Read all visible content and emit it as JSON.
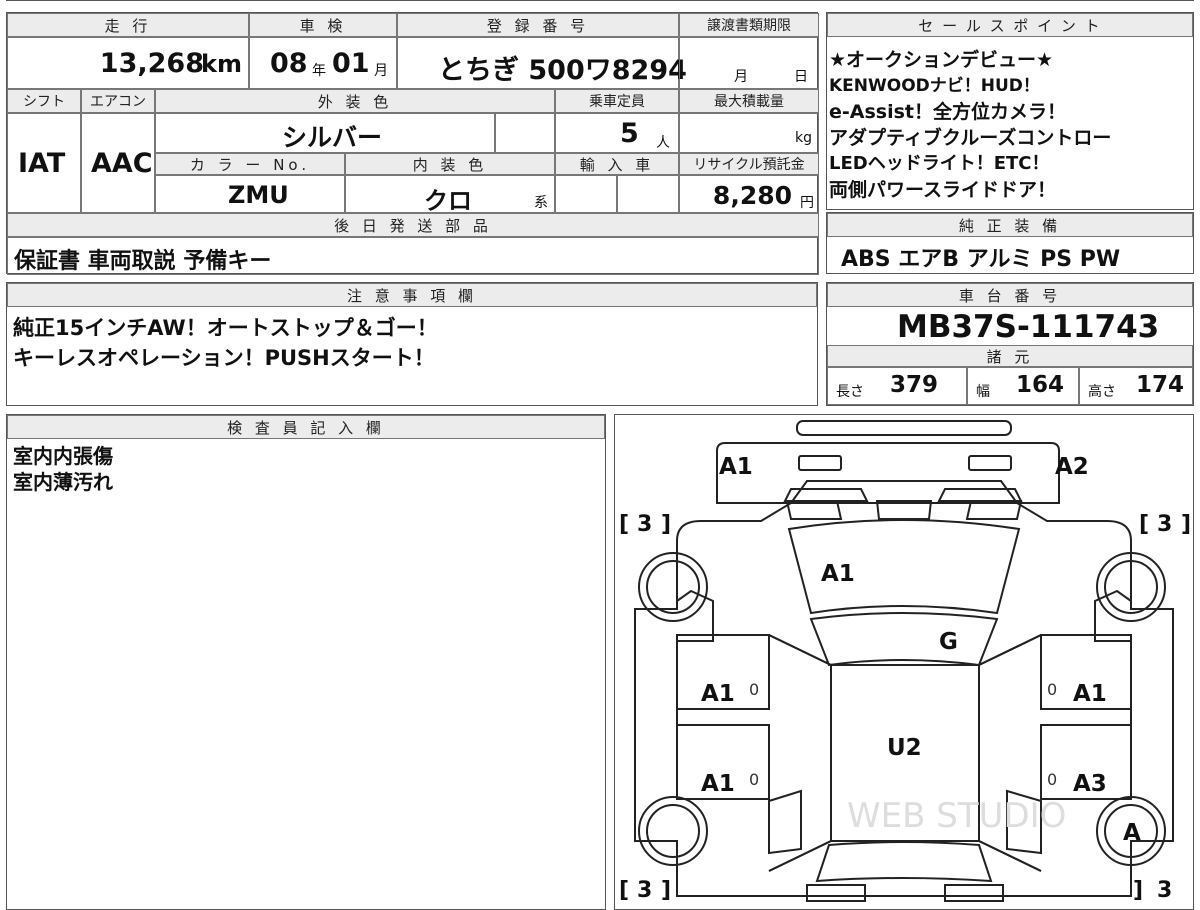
{
  "top_info": {
    "headers": {
      "mileage": "走 行",
      "inspection": "車 検",
      "registration": "登 録 番 号",
      "transfer_deadline": "譲渡書類期限",
      "shift": "シフト",
      "aircon": "エアコン",
      "exterior_color": "外 装 色",
      "capacity": "乗車定員",
      "max_load": "最大積載量",
      "color_no": "カ ラ ー No.",
      "interior_color": "内 装 色",
      "import": "輸 入 車",
      "recycle": "リサイクル預託金",
      "later_parts": "後 日 発 送 部 品"
    },
    "mileage": "13,268",
    "mileage_unit": "km",
    "inspection_year": "08",
    "inspection_year_unit": "年",
    "inspection_month": "01",
    "inspection_month_unit": "月",
    "registration": "とちぎ 500ワ8294",
    "deadline_month_unit": "月",
    "deadline_day_unit": "日",
    "shift": "IAT",
    "aircon": "AAC",
    "exterior_color": "シルバー",
    "capacity": "5",
    "capacity_unit": "人",
    "load_unit": "kg",
    "color_no": "ZMU",
    "interior_color": "クロ",
    "interior_suffix": "系",
    "recycle_fee": "8,280",
    "recycle_unit": "円",
    "later_parts": "保証書 車両取説 予備キー"
  },
  "sales_points": {
    "header": "セ ー ル ス ポ イ ン ト",
    "lines": [
      "★オークションデビュー★",
      "KENWOODナビ！HUD！",
      "e-Assist！全方位カメラ！",
      "アダプティブクルーズコントロー",
      "LEDヘッドライト！ETC！",
      "両側パワースライドドア！"
    ]
  },
  "equipment": {
    "header": "純 正 装 備",
    "items": "ABS エアB アルミ PS PW"
  },
  "notes": {
    "header": "注 意 事 項 欄",
    "lines": [
      "純正15インチAW！オートストップ＆ゴー！",
      "キーレスオペレーション！PUSHスタート！"
    ]
  },
  "chassis": {
    "header": "車 台 番 号",
    "number": "MB37S-111743"
  },
  "specs": {
    "header": "諸 元",
    "length_label": "長さ",
    "length": "379",
    "width_label": "幅",
    "width": "164",
    "height_label": "高さ",
    "height": "174"
  },
  "inspector": {
    "header": "検 査 員 記 入 欄",
    "lines": [
      "室内内張傷",
      "室内薄汚れ"
    ]
  },
  "diagram": {
    "marks": {
      "mirror_left": "A1",
      "mirror_right": "A2",
      "hood": "A1",
      "windshield": "G",
      "front_left_door": "A1",
      "rear_left_door": "A1",
      "front_right_door": "A1",
      "rear_right_door": "A3",
      "roof": "U2",
      "rear_right_wheel": "A"
    },
    "tire_tread": "3",
    "door_pillar_mark": "0",
    "watermark": "WEB STUDIO"
  }
}
